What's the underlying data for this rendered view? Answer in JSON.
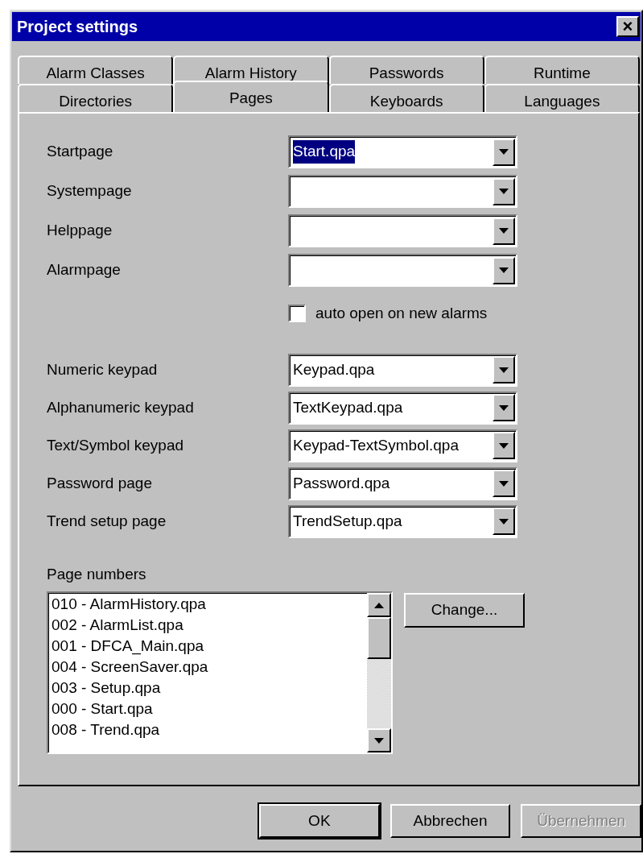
{
  "window": {
    "title": "Project settings",
    "close_label": "×"
  },
  "tab_rows": [
    {
      "tabs": [
        {
          "label": "Alarm Classes",
          "selected": false
        },
        {
          "label": "Alarm History",
          "selected": false
        },
        {
          "label": "Passwords",
          "selected": false
        },
        {
          "label": "Runtime",
          "selected": false
        }
      ]
    },
    {
      "tabs": [
        {
          "label": "Directories",
          "selected": false
        },
        {
          "label": "Pages",
          "selected": true
        },
        {
          "label": "Keyboards",
          "selected": false
        },
        {
          "label": "Languages",
          "selected": false
        }
      ]
    }
  ],
  "page_fields": [
    {
      "label": "Startpage",
      "value": "Start.qpa",
      "highlighted": true
    },
    {
      "label": "Systempage"
    },
    {
      "label": "Helppage"
    },
    {
      "label": "Alarmpage"
    }
  ],
  "auto_open": {
    "label": "auto open on new alarms",
    "checked": false
  },
  "keypad_fields": [
    {
      "label": "Numeric keypad",
      "value": "Keypad.qpa",
      "highlighted": false
    },
    {
      "label": "Alphanumeric keypad",
      "value": "TextKeypad.qpa",
      "highlighted": false
    },
    {
      "label": "Text/Symbol keypad",
      "value": "Keypad-TextSymbol.qpa",
      "highlighted": false
    },
    {
      "label": "Password page",
      "value": "Password.qpa",
      "highlighted": false
    },
    {
      "label": "Trend setup page",
      "value": "TrendSetup.qpa",
      "highlighted": false
    }
  ],
  "page_numbers": {
    "label": "Page numbers",
    "items": [
      "010 - AlarmHistory.qpa",
      "002 - AlarmList.qpa",
      "001 - DFCA_Main.qpa",
      "004 - ScreenSaver.qpa",
      "003 - Setup.qpa",
      "000 - Start.qpa",
      "008 - Trend.qpa"
    ],
    "change_button": "Change..."
  },
  "buttons": [
    {
      "label": "OK",
      "default": true,
      "disabled": false
    },
    {
      "label": "Abbrechen",
      "default": false,
      "disabled": false
    },
    {
      "label": "Übernehmen",
      "default": false,
      "disabled": true
    }
  ]
}
